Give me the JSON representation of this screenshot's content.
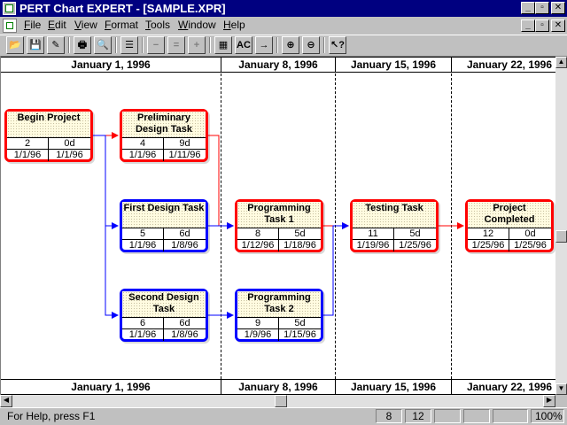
{
  "window": {
    "title": "PERT Chart EXPERT - [SAMPLE.XPR]",
    "caption_buttons": [
      "_",
      "▫",
      "✕"
    ],
    "doc_buttons": [
      "_",
      "▫",
      "✕"
    ]
  },
  "menu": {
    "items": [
      {
        "underline": "F",
        "rest": "ile"
      },
      {
        "underline": "E",
        "rest": "dit"
      },
      {
        "underline": "V",
        "rest": "iew"
      },
      {
        "underline": "F",
        "rest": "ormat"
      },
      {
        "underline": "T",
        "rest": "ools"
      },
      {
        "underline": "W",
        "rest": "indow"
      },
      {
        "underline": "H",
        "rest": "elp"
      }
    ]
  },
  "toolbar": {
    "buttons": [
      {
        "icon": "open-folder-icon",
        "glyph": "📂",
        "enabled": true
      },
      {
        "icon": "save-icon",
        "glyph": "💾",
        "enabled": true
      },
      {
        "icon": "edit-icon",
        "glyph": "✎",
        "enabled": true
      },
      {
        "icon": "print-icon",
        "glyph": "🖶",
        "enabled": true
      },
      {
        "icon": "print-preview-icon",
        "glyph": "🔍",
        "enabled": true
      },
      {
        "icon": "task-list-icon",
        "glyph": "☰",
        "enabled": true
      },
      {
        "icon": "remove-task-icon",
        "glyph": "−",
        "enabled": false
      },
      {
        "icon": "remove-link-icon",
        "glyph": "=",
        "enabled": false
      },
      {
        "icon": "add-link-icon",
        "glyph": "+",
        "enabled": false
      },
      {
        "icon": "calendar-icon",
        "glyph": "▦",
        "enabled": true
      },
      {
        "icon": "spell-check-icon",
        "glyph": "AC",
        "enabled": true
      },
      {
        "icon": "link-arrow-icon",
        "glyph": "→",
        "enabled": true
      },
      {
        "icon": "zoom-in-icon",
        "glyph": "⊕",
        "enabled": true
      },
      {
        "icon": "zoom-out-icon",
        "glyph": "⊖",
        "enabled": true
      },
      {
        "icon": "context-help-icon",
        "glyph": "↖?",
        "enabled": true
      }
    ]
  },
  "timeline": {
    "columns": [
      "January 1, 1996",
      "January 8, 1996",
      "January 15, 1996",
      "January 22, 1996"
    ]
  },
  "tasks": [
    {
      "id": "begin",
      "name": "Begin Project",
      "number": "2",
      "duration": "0d",
      "start": "1/1/96",
      "finish": "1/1/96",
      "critical": true
    },
    {
      "id": "prelim",
      "name": "Preliminary Design Task",
      "number": "4",
      "duration": "9d",
      "start": "1/1/96",
      "finish": "1/11/96",
      "critical": true
    },
    {
      "id": "first",
      "name": "First Design Task",
      "number": "5",
      "duration": "6d",
      "start": "1/1/96",
      "finish": "1/8/96",
      "critical": false
    },
    {
      "id": "second",
      "name": "Second Design Task",
      "number": "6",
      "duration": "6d",
      "start": "1/1/96",
      "finish": "1/8/96",
      "critical": false
    },
    {
      "id": "prog1",
      "name": "Programming Task 1",
      "number": "8",
      "duration": "5d",
      "start": "1/12/96",
      "finish": "1/18/96",
      "critical": true
    },
    {
      "id": "prog2",
      "name": "Programming Task 2",
      "number": "9",
      "duration": "5d",
      "start": "1/9/96",
      "finish": "1/15/96",
      "critical": false
    },
    {
      "id": "testing",
      "name": "Testing Task",
      "number": "11",
      "duration": "5d",
      "start": "1/19/96",
      "finish": "1/25/96",
      "critical": true
    },
    {
      "id": "complete",
      "name": "Project Completed",
      "number": "12",
      "duration": "0d",
      "start": "1/25/96",
      "finish": "1/25/96",
      "critical": true
    }
  ],
  "colors": {
    "critical": "#ff0000",
    "noncritical": "#0000ff",
    "titlebar": "#000080",
    "node_fill": "#fffbe0"
  },
  "statusbar": {
    "help_text": "For Help, press F1",
    "field1": "8",
    "field2": "12",
    "zoom": "100%"
  }
}
